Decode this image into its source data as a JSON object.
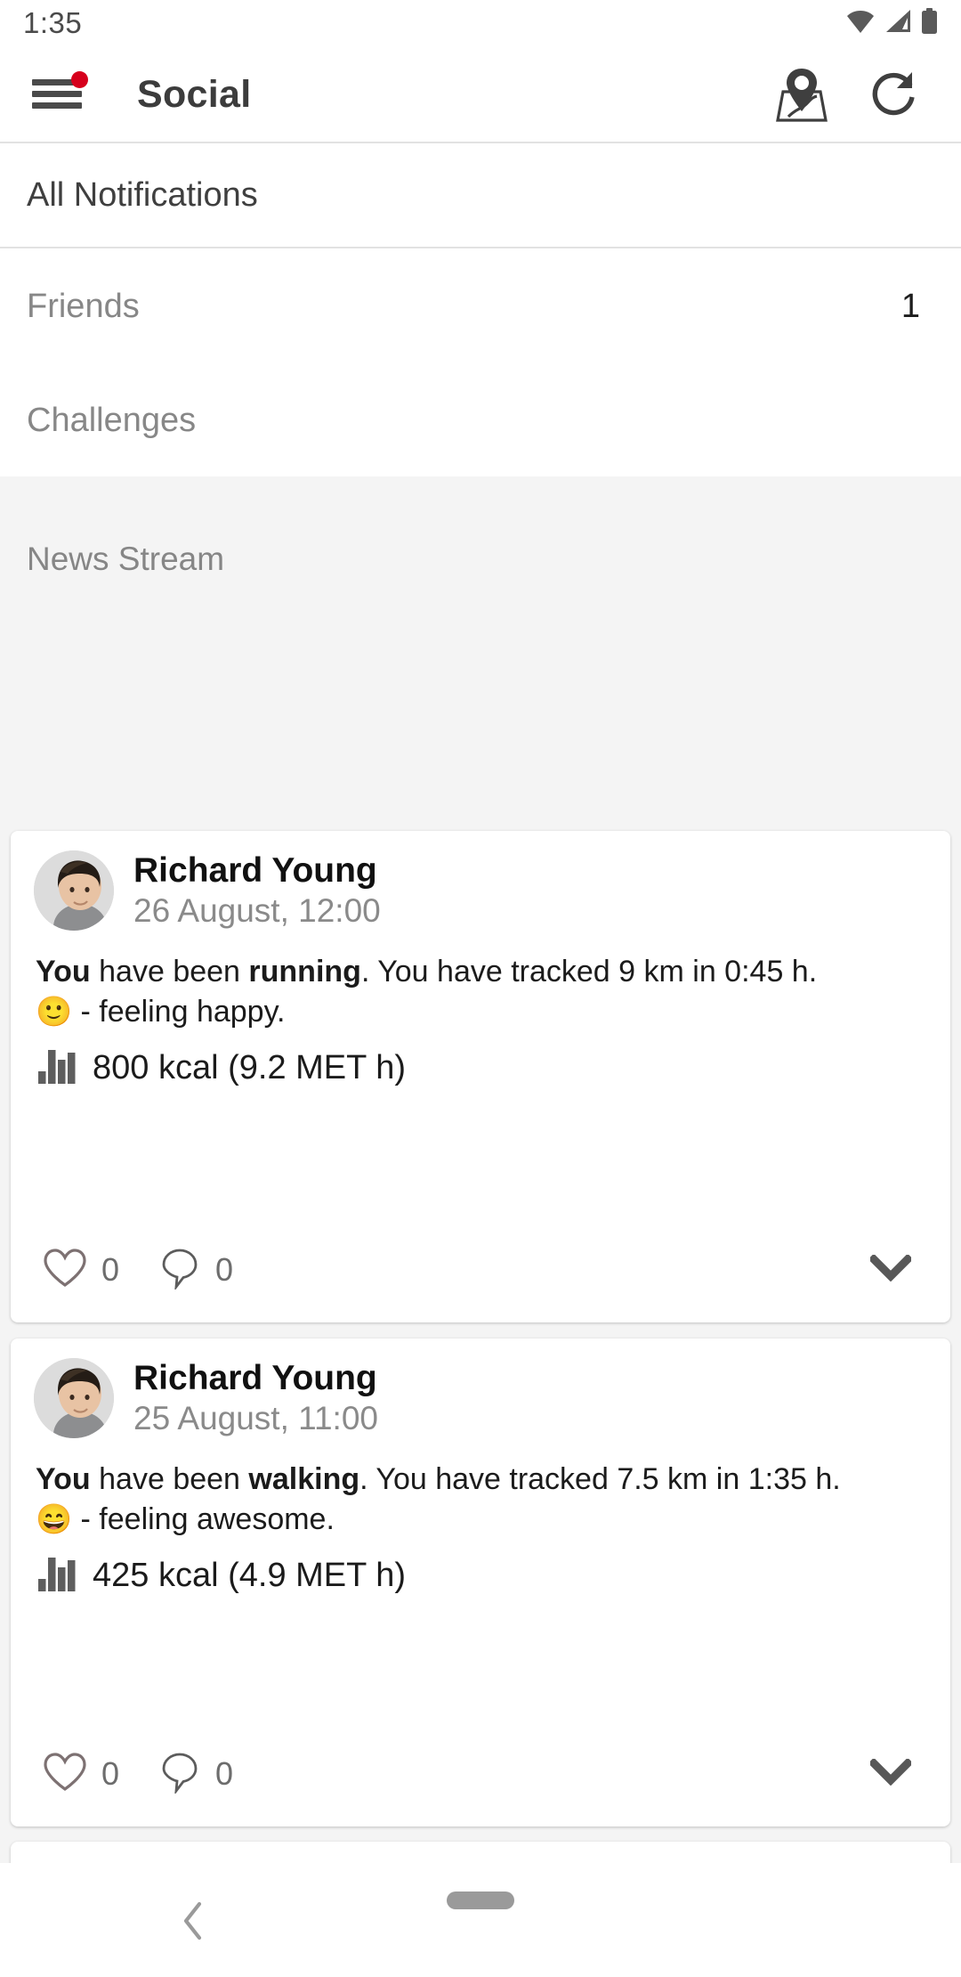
{
  "statusbar": {
    "time": "1:35",
    "icons": [
      "wifi-icon",
      "cellular-signal-icon",
      "battery-icon"
    ]
  },
  "appbar": {
    "title": "Social",
    "menu_icon": "hamburger-menu-icon",
    "menu_badge": true,
    "badge_color": "#d6001c",
    "actions": [
      {
        "name": "map-pin-icon",
        "label": "Map"
      },
      {
        "name": "refresh-icon",
        "label": "Refresh"
      }
    ]
  },
  "nav_rows": [
    {
      "label": "All Notifications",
      "count": ""
    },
    {
      "label": "Friends",
      "count": "1"
    },
    {
      "label": "Challenges",
      "count": ""
    }
  ],
  "stream": {
    "title": "News Stream",
    "background": "#f4f4f4",
    "posts": [
      {
        "author": "Richard Young",
        "time": "26 August, 12:00",
        "avatar": "user-avatar",
        "text_prefix": "You",
        "text_mid": " have been ",
        "activity": "running",
        "text_suffix": ". You have tracked 9 km in 0:45 h.",
        "emoji": "🙂",
        "feeling": " - feeling happy.",
        "kcal": "800 kcal (9.2 MET h)",
        "kcal_icon": "bar-chart-icon",
        "like_icon": "heart-icon",
        "likes": "0",
        "comment_icon": "comment-bubble-icon",
        "comments": "0",
        "expand_icon": "chevron-down-icon"
      },
      {
        "author": "Richard Young",
        "time": "25 August, 11:00",
        "avatar": "user-avatar",
        "text_prefix": "You",
        "text_mid": " have been ",
        "activity": "walking",
        "text_suffix": ". You have tracked 7.5 km in 1:35 h.",
        "emoji": "😄",
        "feeling": " - feeling awesome.",
        "kcal": "425 kcal (4.9 MET h)",
        "kcal_icon": "bar-chart-icon",
        "like_icon": "heart-icon",
        "likes": "0",
        "comment_icon": "comment-bubble-icon",
        "comments": "0",
        "expand_icon": "chevron-down-icon"
      }
    ]
  },
  "bottom_nav": {
    "back_icon": "back-chevron-icon",
    "home_indicator": "home-pill-indicator"
  }
}
